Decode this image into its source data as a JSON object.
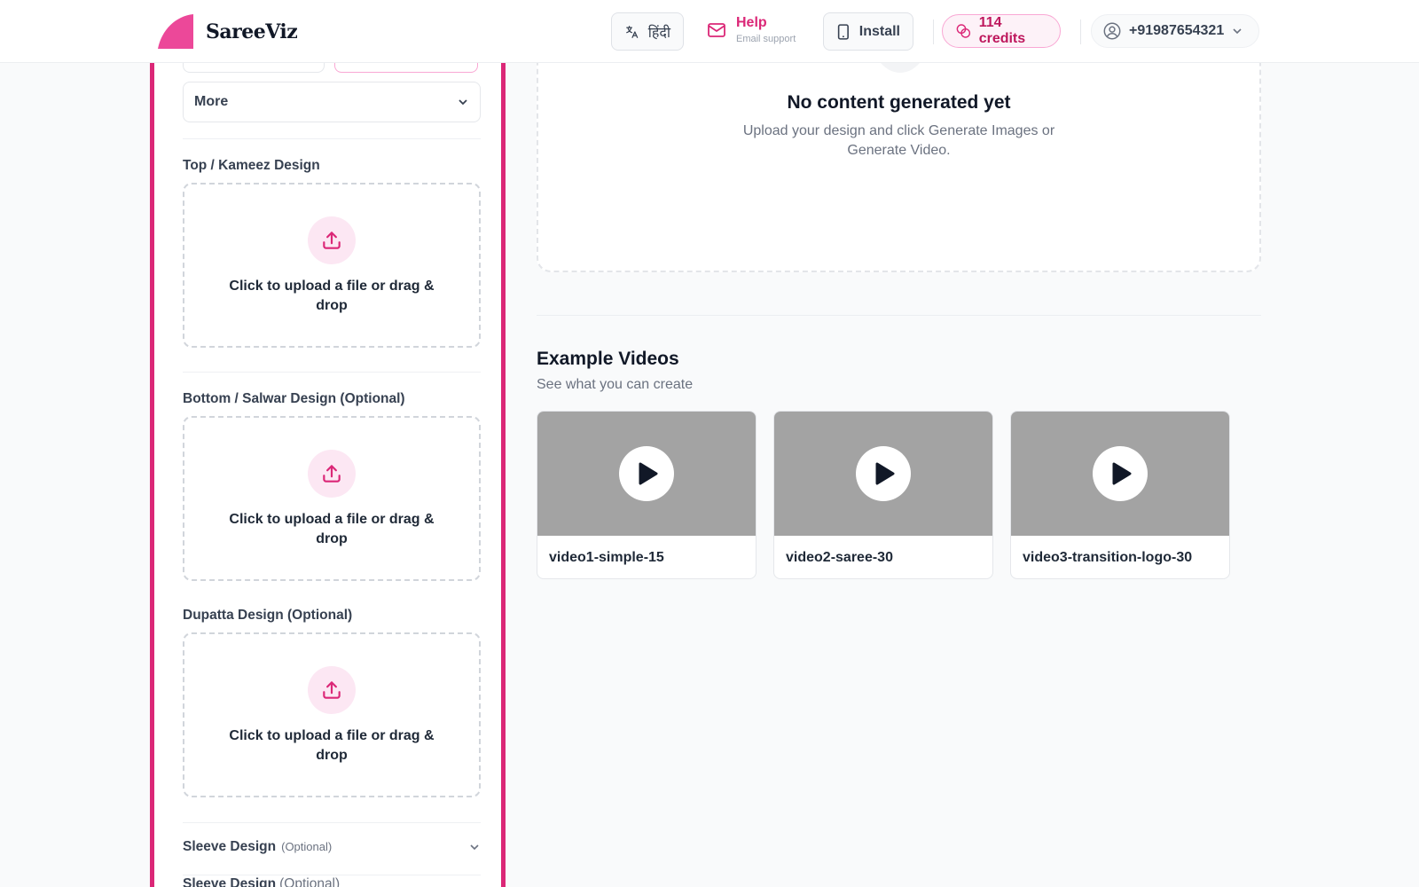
{
  "app": {
    "name": "SareeViz"
  },
  "header": {
    "language_label": "हिंदी",
    "help_label": "Help",
    "help_sub": "Email support",
    "install_label": "Install",
    "credits_label": "114 credits",
    "account_phone": "+91987654321"
  },
  "sidebar": {
    "more_select": "More",
    "sections": [
      {
        "title": "Top / Kameez Design",
        "optional": "",
        "upload_text": "Click to upload a file or drag & drop"
      },
      {
        "title": "Bottom / Salwar Design (Optional)",
        "optional": "",
        "upload_text": "Click to upload a file or drag & drop"
      },
      {
        "title": "Dupatta Design (Optional)",
        "optional": "",
        "upload_text": "Click to upload a file or drag & drop"
      }
    ],
    "sleeve": {
      "title": "Sleeve Design",
      "optional": "(Optional)"
    }
  },
  "main": {
    "empty_title": "No content generated yet",
    "empty_subtitle": "Upload your design and click Generate Images or Generate Video.",
    "examples_title": "Example Videos",
    "examples_subtitle": "See what you can create",
    "videos": [
      {
        "name": "video1-simple-15"
      },
      {
        "name": "video2-saree-30"
      },
      {
        "name": "video3-transition-logo-30"
      }
    ]
  },
  "colors": {
    "accent": "#db2777",
    "accent_light": "#fce7f3",
    "thumb_gray": "#a3a3a3"
  },
  "icons": [
    "translate-icon",
    "mail-icon",
    "phone-icon",
    "credits-icon",
    "user-icon",
    "chevron-down-icon",
    "upload-icon",
    "play-icon"
  ]
}
